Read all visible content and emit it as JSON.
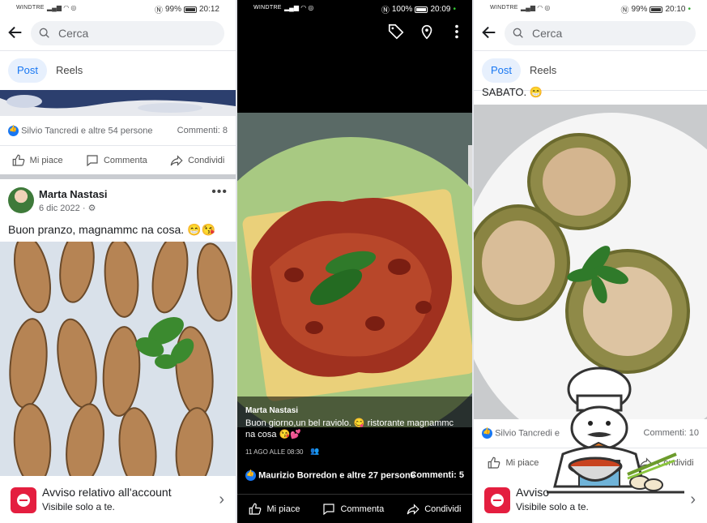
{
  "screens": [
    {
      "status": {
        "carrier": "WINDTRE",
        "battery": "99%",
        "time": "20:12"
      },
      "search_placeholder": "Cerca",
      "tabs": [
        "Post",
        "Reels"
      ],
      "prev_post": {
        "reactions": "Silvio Tancredi e altre 54 persone",
        "comments": "Commenti: 8"
      },
      "actions": {
        "like": "Mi piace",
        "comment": "Commenta",
        "share": "Condividi"
      },
      "post": {
        "author": "Marta Nastasi",
        "date": "6 dic 2022",
        "caption": "Buon pranzo, magnammc na cosa. 😁😘"
      },
      "notice": {
        "title": "Avviso relativo all'account",
        "subtitle": "Visibile solo a te."
      }
    },
    {
      "status": {
        "carrier": "WINDTRE",
        "battery": "100%",
        "time": "20:09"
      },
      "overlay": {
        "author": "Marta Nastasi",
        "caption": "Buon giorno,un bel raviolo. 😋 ristorante magnammc na cosa 😘💕",
        "date": "11 AGO ALLE 08:30"
      },
      "reactions": "Maurizio Borredon e altre 27 persone",
      "comments": "Commenti: 5",
      "actions": {
        "like": "Mi piace",
        "comment": "Commenta",
        "share": "Condividi"
      }
    },
    {
      "status": {
        "carrier": "WINDTRE",
        "battery": "99%",
        "time": "20:10"
      },
      "search_placeholder": "Cerca",
      "tabs": [
        "Post",
        "Reels"
      ],
      "caption_tail": "SABATO. 😁",
      "reactions": "Silvio Tancredi e",
      "comments": "Commenti: 10",
      "actions": {
        "like": "Mi piace",
        "share": "Condividi"
      },
      "notice": {
        "title": "Avviso",
        "subtitle": "Visibile solo a te."
      }
    }
  ],
  "icons": [
    "back-arrow-icon",
    "search-icon",
    "like-icon",
    "comment-icon",
    "share-icon",
    "gear-icon",
    "tag-icon",
    "location-pin-icon",
    "more-vert-icon",
    "chevron-right-icon",
    "account-notice-icon",
    "chef-sticker"
  ],
  "colors": {
    "fb_blue": "#1877f2",
    "notice_red": "#e41e3f",
    "tab_active_bg": "#e7f0fd"
  }
}
